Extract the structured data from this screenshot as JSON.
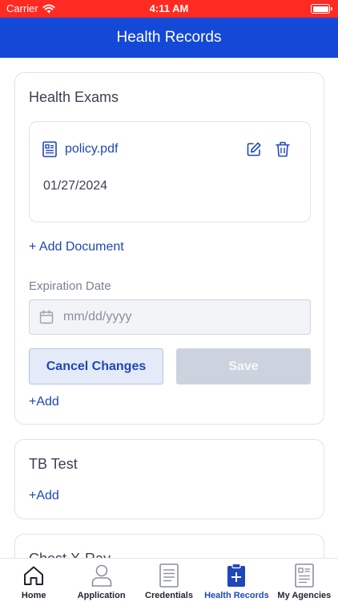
{
  "status_bar": {
    "carrier": "Carrier",
    "time": "4:11 AM"
  },
  "header": {
    "title": "Health Records"
  },
  "health_exams": {
    "title": "Health Exams",
    "document": {
      "name": "policy.pdf",
      "date": "01/27/2024"
    },
    "add_document_label": "+ Add Document",
    "expiration_label": "Expiration Date",
    "expiration_placeholder": "mm/dd/yyyy",
    "expiration_value": "",
    "cancel_label": "Cancel Changes",
    "save_label": "Save",
    "add_label": "+Add"
  },
  "tb_test": {
    "title": "TB Test",
    "add_label": "+Add"
  },
  "chest_xray": {
    "title": "Chest X-Ray"
  },
  "tabs": [
    {
      "label": "Home",
      "icon": "home-icon"
    },
    {
      "label": "Application",
      "icon": "person-icon"
    },
    {
      "label": "Credentials",
      "icon": "document-icon"
    },
    {
      "label": "Health Records",
      "icon": "clipboard-plus-icon",
      "active": true
    },
    {
      "label": "My Agencies",
      "icon": "agency-doc-icon"
    }
  ],
  "colors": {
    "status_bar": "#ff2a22",
    "header": "#1448d6",
    "accent": "#1f47b8"
  }
}
